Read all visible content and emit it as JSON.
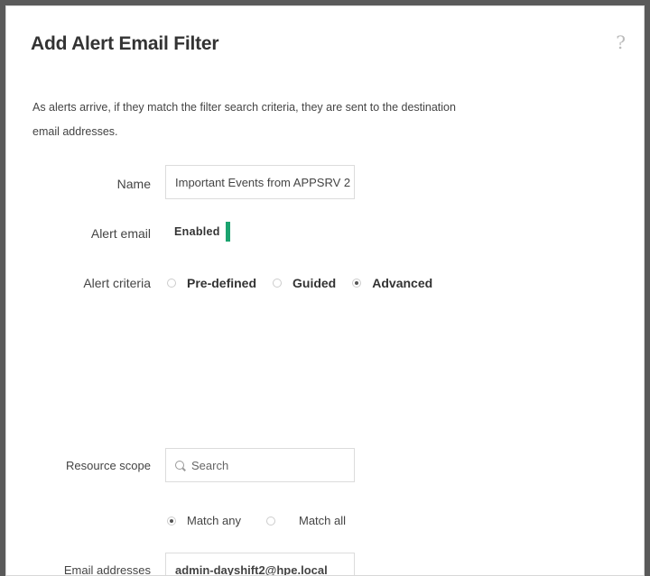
{
  "dialog": {
    "title": "Add Alert Email Filter",
    "help_symbol": "?",
    "description": "As  alerts arrive, if they match the filter search criteria, they are sent to the destination email addresses."
  },
  "form": {
    "name": {
      "label": "Name",
      "value": "Important Events from APPSRV 2"
    },
    "alert_email": {
      "label": "Alert email",
      "state_label": "Enabled",
      "accent_color": "#1ba36f"
    },
    "alert_criteria": {
      "label": "Alert criteria",
      "options": [
        "Pre-defined",
        "Guided",
        "Advanced"
      ],
      "selected": "Advanced"
    },
    "resource_scope": {
      "label": "Resource scope",
      "placeholder": "Search",
      "match_options": [
        "Match any",
        "Match all"
      ],
      "match_selected": "Match any"
    },
    "email_addresses": {
      "label": "Email addresses",
      "value": "admin-dayshift2@hpe.local"
    }
  }
}
